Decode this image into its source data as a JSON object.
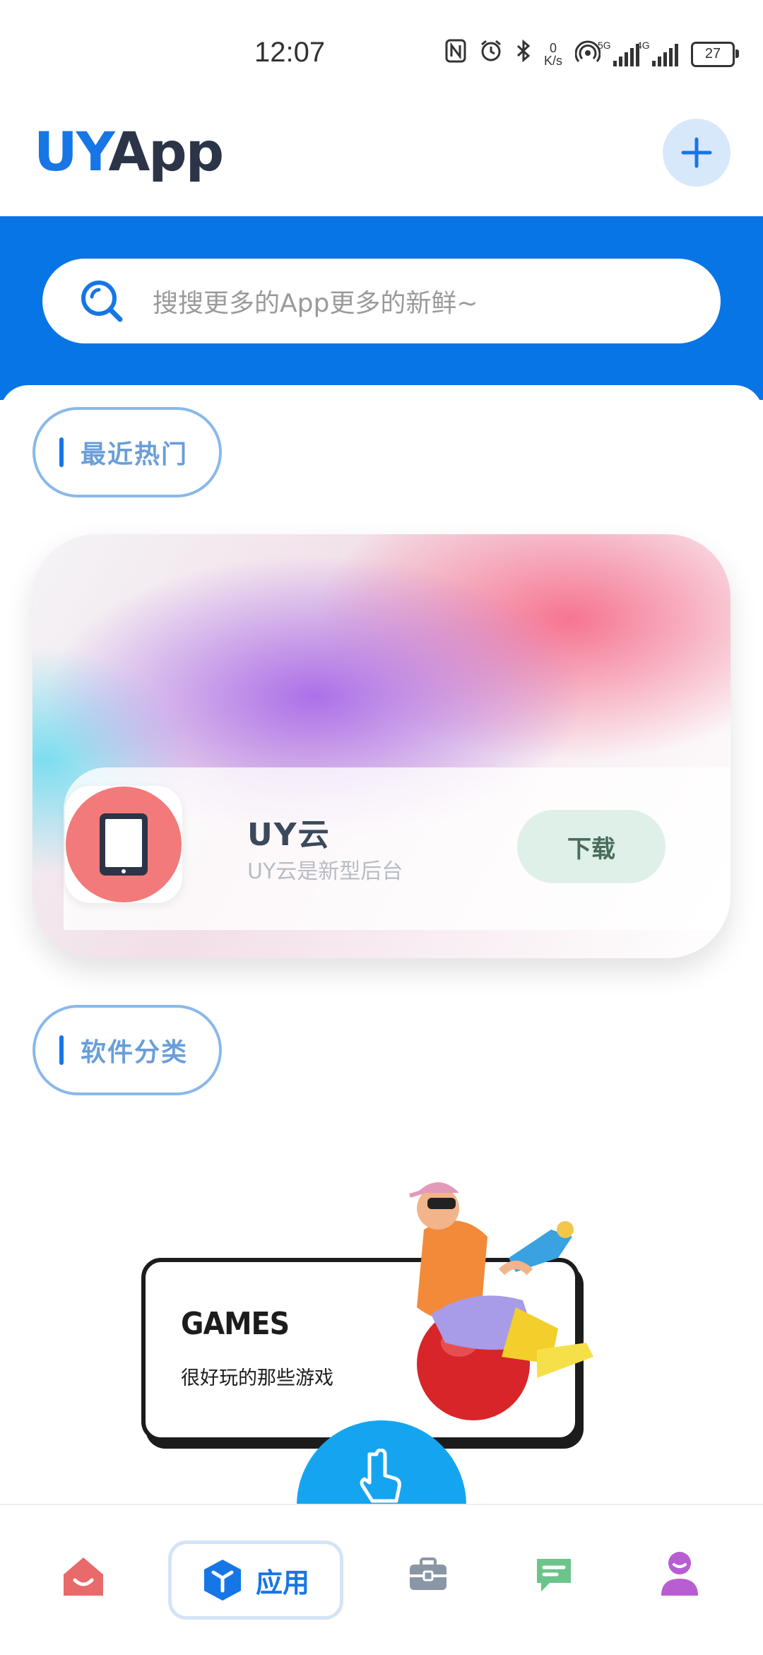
{
  "status_bar": {
    "time": "12:07",
    "net_speed_value": "0",
    "net_speed_unit": "K/s",
    "sig1_tag": "5G",
    "sig2_tag": "4G",
    "battery": "27"
  },
  "header": {
    "logo_part1": "UY",
    "logo_part2": "App"
  },
  "search": {
    "placeholder": "搜搜更多的App更多的新鲜~"
  },
  "sections": {
    "hot": "最近热门",
    "category": "软件分类"
  },
  "hot_app": {
    "name": "UY云",
    "description": "UY云是新型后台",
    "download_label": "下载"
  },
  "category_card": {
    "title": "GAMES",
    "subtitle": "很好玩的那些游戏"
  },
  "bottom_nav": {
    "active_label": "应用",
    "items": [
      "home-icon",
      "app-cube-icon",
      "toolbox-icon",
      "message-icon",
      "profile-icon"
    ]
  },
  "colors": {
    "primary": "#1776e6",
    "band": "#0875e6",
    "fab": "#15a5f0",
    "app_icon_bg": "#f27a7a"
  }
}
